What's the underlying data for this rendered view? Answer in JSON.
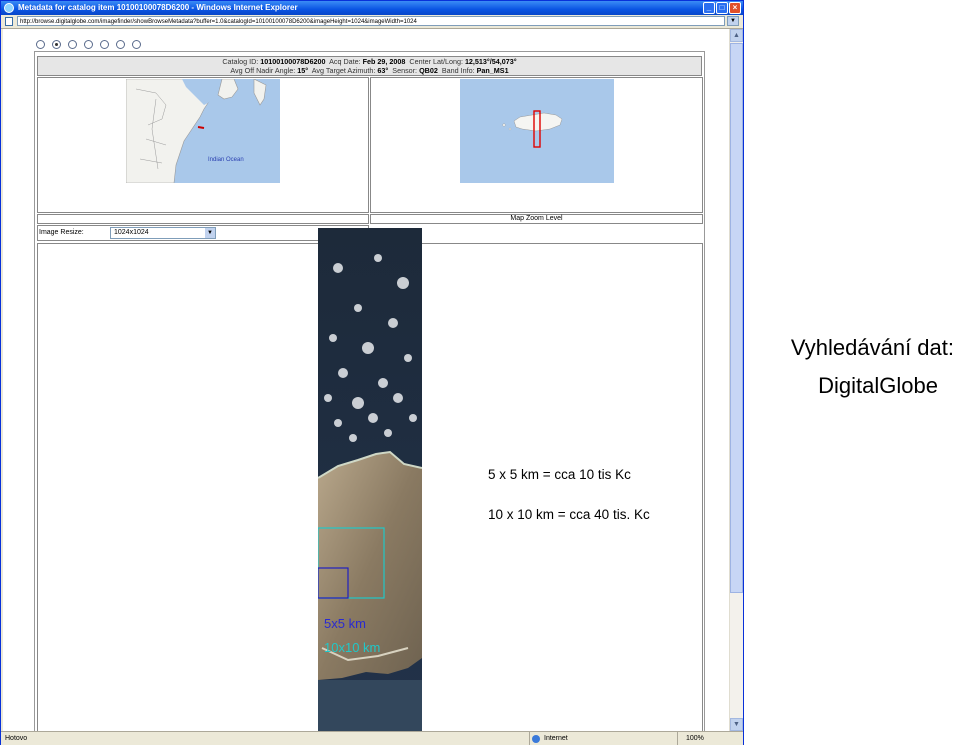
{
  "window": {
    "title": "Metadata for catalog item 10100100078D6200 - Windows Internet Explorer",
    "url": "http://browse.digitalglobe.com/imagefinder/showBrowseMetadata?buffer=1.0&catalogId=10100100078D6200&imageHeight=1024&imageWidth=1024",
    "controls": {
      "minimize": "_",
      "maximize": "□",
      "close": "×"
    }
  },
  "metadata": {
    "catalog_label": "Catalog ID:",
    "catalog_value": "10100100078D6200",
    "acq_label": "Acq Date:",
    "acq_value": "Feb 29, 2008",
    "center_label": "Center Lat/Long:",
    "center_value": "12,513°/54,073°",
    "nadir_label": "Avg Off Nadir Angle:",
    "nadir_value": "15°",
    "azimuth_label": "Avg Target Azimuth:",
    "azimuth_value": "63°",
    "sensor_label": "Sensor:",
    "sensor_value": "QB02",
    "band_label": "Band Info:",
    "band_value": "Pan_MS1"
  },
  "overview_map": {
    "ocean_label": "Indian Ocean"
  },
  "zoom_label": "Map Zoom Level",
  "image_resize": {
    "label": "Image Resize:",
    "selected": "1024x1024"
  },
  "overlay": {
    "line1": "5 x 5 km = cca 10 tis Kc",
    "line2": "10 x 10 km = cca 40 tis. Kc",
    "label_5": "5x5 km",
    "label_10": "10x10 km"
  },
  "side": {
    "line1": "Vyhledávání dat:",
    "line2": "DigitalGlobe"
  },
  "status": {
    "left": "Hotovo",
    "zone": "Internet",
    "zoom": "100%"
  },
  "colors": {
    "box5": "#2020c0",
    "box10": "#20c8c8",
    "titlebar": "#0a54e3"
  }
}
